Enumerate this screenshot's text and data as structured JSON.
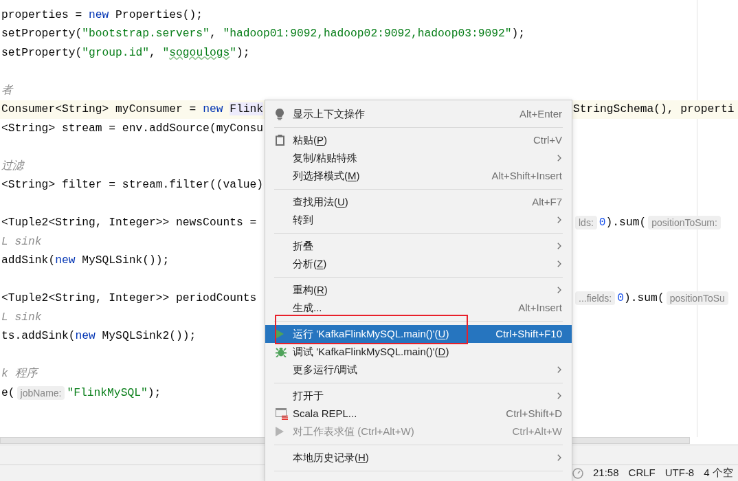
{
  "editor": {
    "lines": [
      {
        "current": false,
        "left": [
          {
            "kind": "plain",
            "text": "properties = "
          },
          {
            "kind": "keyword",
            "text": "new"
          },
          {
            "kind": "plain",
            "text": " Properties();"
          }
        ]
      },
      {
        "current": false,
        "left": [
          {
            "kind": "plain",
            "text": "setProperty("
          },
          {
            "kind": "string",
            "text": "\"bootstrap.servers\""
          },
          {
            "kind": "plain",
            "text": ", "
          },
          {
            "kind": "string",
            "text": "\"hadoop01:9092,hadoop02:9092,hadoop03:9092\""
          },
          {
            "kind": "plain",
            "text": ");"
          }
        ]
      },
      {
        "current": false,
        "left": [
          {
            "kind": "plain",
            "text": "setProperty("
          },
          {
            "kind": "string",
            "text": "\"group.id\""
          },
          {
            "kind": "plain",
            "text": ", "
          },
          {
            "kind": "string",
            "text": "\""
          },
          {
            "kind": "typo",
            "text": "sogoulogs"
          },
          {
            "kind": "string",
            "text": "\""
          },
          {
            "kind": "plain",
            "text": ");"
          }
        ]
      },
      {
        "current": false
      },
      {
        "current": false,
        "left": [
          {
            "kind": "comment",
            "text": "者"
          }
        ]
      },
      {
        "current": true,
        "left": [
          {
            "kind": "plain",
            "text": "Consumer<String> myConsumer = "
          },
          {
            "kind": "keyword",
            "text": "new "
          },
          {
            "kind": "usage",
            "text": "Flink"
          }
        ],
        "right": [
          {
            "kind": "plain",
            "text": "StringSchema(), properti"
          }
        ]
      },
      {
        "current": false,
        "left": [
          {
            "kind": "plain",
            "text": "<String> stream = env.addSource(myConsu"
          }
        ]
      },
      {
        "current": false
      },
      {
        "current": false,
        "left": [
          {
            "kind": "comment",
            "text": "过滤"
          }
        ]
      },
      {
        "current": false,
        "left": [
          {
            "kind": "plain",
            "text": "<String> filter = stream.filter((value)"
          }
        ]
      },
      {
        "current": false
      },
      {
        "current": false,
        "left": [
          {
            "kind": "plain",
            "text": "<Tuple2<String, Integer>> newsCounts ="
          }
        ],
        "right": [
          {
            "kind": "hint",
            "text": "lds:"
          },
          {
            "kind": "number",
            "text": "0"
          },
          {
            "kind": "plain",
            "text": ").sum("
          },
          {
            "kind": "hint",
            "text": "positionToSum:"
          }
        ]
      },
      {
        "current": false,
        "left": [
          {
            "kind": "comment",
            "text": "L sink"
          }
        ]
      },
      {
        "current": false,
        "left": [
          {
            "kind": "plain",
            "text": "addSink("
          },
          {
            "kind": "keyword",
            "text": "new"
          },
          {
            "kind": "plain",
            "text": " MySQLSink());"
          }
        ]
      },
      {
        "current": false
      },
      {
        "current": false,
        "left": [
          {
            "kind": "plain",
            "text": "<Tuple2<String, Integer>> periodCounts"
          }
        ],
        "right": [
          {
            "kind": "hint",
            "text": "...fields:"
          },
          {
            "kind": "number",
            "text": "0"
          },
          {
            "kind": "plain",
            "text": ").sum("
          },
          {
            "kind": "hint",
            "text": "positionToSu"
          }
        ]
      },
      {
        "current": false,
        "left": [
          {
            "kind": "comment",
            "text": "L sink"
          }
        ]
      },
      {
        "current": false,
        "left": [
          {
            "kind": "plain",
            "text": "ts.addSink("
          },
          {
            "kind": "keyword",
            "text": "new"
          },
          {
            "kind": "plain",
            "text": " MySQLSink2());"
          }
        ]
      },
      {
        "current": false
      },
      {
        "current": false,
        "left": [
          {
            "kind": "comment",
            "text": "k 程序"
          }
        ]
      },
      {
        "current": false,
        "left": [
          {
            "kind": "plain",
            "text": "e("
          },
          {
            "kind": "hint",
            "text": "jobName:"
          },
          {
            "kind": "string",
            "text": "\"FlinkMySQL\""
          },
          {
            "kind": "plain",
            "text": ");"
          }
        ]
      },
      {
        "current": false
      }
    ]
  },
  "context_menu": {
    "groups": [
      {
        "items": [
          {
            "kind": "intentions",
            "label": "显示上下文操作",
            "shortcut": "Alt+Enter",
            "selected": false,
            "disabled": false,
            "annotated": false
          }
        ]
      },
      {
        "items": [
          {
            "kind": "paste",
            "label": "粘贴(",
            "mnemonic": "P",
            "label_end": ")",
            "shortcut": "Ctrl+V",
            "selected": false,
            "disabled": false,
            "annotated": false
          },
          {
            "kind": "submenu",
            "label": "复制/粘贴特殊",
            "selected": false,
            "disabled": false,
            "annotated": false
          },
          {
            "kind": "plain",
            "label": "列选择模式(",
            "mnemonic": "M",
            "label_end": ")",
            "shortcut": "Alt+Shift+Insert",
            "selected": false,
            "disabled": false,
            "annotated": false
          }
        ]
      },
      {
        "items": [
          {
            "kind": "plain",
            "label": "查找用法(",
            "mnemonic": "U",
            "label_end": ")",
            "shortcut": "Alt+F7",
            "selected": false,
            "disabled": false,
            "annotated": false
          },
          {
            "kind": "submenu",
            "label": "转到",
            "selected": false,
            "disabled": false,
            "annotated": false
          }
        ]
      },
      {
        "items": [
          {
            "kind": "submenu",
            "label": "折叠",
            "selected": false,
            "disabled": false,
            "annotated": false
          },
          {
            "kind": "submenu",
            "label": "分析(",
            "mnemonic": "Z",
            "label_end": ")",
            "selected": false,
            "disabled": false,
            "annotated": false
          }
        ]
      },
      {
        "items": [
          {
            "kind": "submenu",
            "label": "重构(",
            "mnemonic": "R",
            "label_end": ")",
            "selected": false,
            "disabled": false,
            "annotated": false
          },
          {
            "kind": "plain",
            "label": "生成...",
            "shortcut": "Alt+Insert",
            "selected": false,
            "disabled": false,
            "annotated": false
          }
        ]
      },
      {
        "items": [
          {
            "kind": "run",
            "label": "运行 'KafkaFlinkMySQL.main()'(",
            "mnemonic": "U",
            "label_end": ")",
            "shortcut": "Ctrl+Shift+F10",
            "selected": true,
            "disabled": false,
            "annotated": true
          },
          {
            "kind": "debug",
            "label": "调试 'KafkaFlinkMySQL.main()'(",
            "mnemonic": "D",
            "label_end": ")",
            "selected": false,
            "disabled": false,
            "annotated": false
          },
          {
            "kind": "submenu",
            "label": "更多运行/调试",
            "selected": false,
            "disabled": false,
            "annotated": false
          }
        ]
      },
      {
        "items": [
          {
            "kind": "submenu",
            "label": "打开于",
            "selected": false,
            "disabled": false,
            "annotated": false
          },
          {
            "kind": "repl",
            "label": "Scala REPL...",
            "shortcut": "Ctrl+Shift+D",
            "selected": false,
            "disabled": false,
            "annotated": false
          },
          {
            "kind": "evaluate",
            "label": "对工作表求值 (Ctrl+Alt+W)",
            "shortcut": "Ctrl+Alt+W",
            "selected": false,
            "disabled": true,
            "annotated": false
          }
        ]
      },
      {
        "items": [
          {
            "kind": "submenu",
            "label": "本地历史记录(",
            "mnemonic": "H",
            "label_end": ")",
            "selected": false,
            "disabled": false,
            "annotated": false
          }
        ]
      }
    ]
  },
  "status_bar": {
    "items": [
      "21:58",
      "CRLF",
      "UTF-8",
      "4 个空"
    ]
  }
}
